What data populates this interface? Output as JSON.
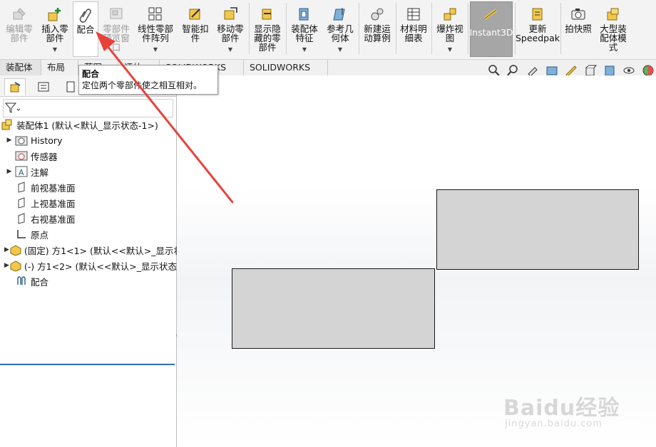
{
  "ribbon": {
    "buttons": [
      {
        "id": "edit-component",
        "label": "编辑零\n部件",
        "icon": "edit-component-icon",
        "disabled": true
      },
      {
        "id": "insert-component",
        "label": "插入零\n部件",
        "icon": "insert-component-icon"
      },
      {
        "id": "mate",
        "label": "配合",
        "icon": "paperclip-icon"
      },
      {
        "id": "component-preview",
        "label": "零部件\n预览窗\n口",
        "icon": "preview-window-icon",
        "disabled": true
      },
      {
        "id": "linear-pattern",
        "label": "线性零部\n件阵列",
        "icon": "linear-pattern-icon"
      },
      {
        "id": "smart-fasteners",
        "label": "智能扣\n件",
        "icon": "smart-fastener-icon"
      },
      {
        "id": "move-component",
        "label": "移动零\n部件",
        "icon": "move-component-icon"
      },
      {
        "id": "show-hidden",
        "label": "显示隐\n藏的零\n部件",
        "icon": "show-hidden-icon"
      },
      {
        "id": "assembly-features",
        "label": "装配体\n特征",
        "icon": "assembly-feature-icon"
      },
      {
        "id": "reference-geometry",
        "label": "参考几\n何体",
        "icon": "reference-geometry-icon"
      },
      {
        "id": "new-motion-study",
        "label": "新建运\n动算例",
        "icon": "motion-study-icon"
      },
      {
        "id": "bill-of-materials",
        "label": "材料明\n细表",
        "icon": "bom-icon"
      },
      {
        "id": "exploded-view",
        "label": "爆炸视\n图",
        "icon": "exploded-view-icon"
      },
      {
        "id": "instant3d",
        "label": "Instant3D",
        "icon": "instant3d-icon"
      },
      {
        "id": "update-speedpak",
        "label": "更新\nSpeedpak",
        "icon": "speedpak-icon"
      },
      {
        "id": "snapshot",
        "label": "拍快照",
        "icon": "camera-icon"
      },
      {
        "id": "large-assembly",
        "label": "大型装\n配体模\n式",
        "icon": "large-assembly-icon"
      }
    ]
  },
  "tabs": [
    "装配体",
    "布局",
    "草图",
    "评估",
    "SOLIDWORKS 插件",
    "SOLIDWORKS MBD"
  ],
  "tooltip": {
    "title": "配合",
    "description": "定位两个零部件使之相互相对。"
  },
  "tree": {
    "root": "装配体1  (默认<默认_显示状态-1>)",
    "items": [
      {
        "label": "History",
        "icon": "history-folder-icon",
        "expandable": true
      },
      {
        "label": "传感器",
        "icon": "sensor-icon",
        "expandable": false
      },
      {
        "label": "注解",
        "icon": "annotation-icon",
        "expandable": true
      },
      {
        "label": "前视基准面",
        "icon": "plane-icon",
        "expandable": false
      },
      {
        "label": "上视基准面",
        "icon": "plane-icon",
        "expandable": false
      },
      {
        "label": "右视基准面",
        "icon": "plane-icon",
        "expandable": false
      },
      {
        "label": "原点",
        "icon": "origin-icon",
        "expandable": false
      },
      {
        "label": "(固定) 方1<1> (默认<<默认>_显示状",
        "icon": "part-icon",
        "expandable": true
      },
      {
        "label": "(-) 方1<2> (默认<<默认>_显示状态",
        "icon": "part-icon",
        "expandable": true
      },
      {
        "label": "配合",
        "icon": "mates-icon",
        "expandable": false
      }
    ]
  },
  "watermark": {
    "brand": "Baidu经验",
    "url": "jingyan.baidu.com"
  },
  "colors": {
    "accent": "#2f6bb0",
    "arrow": "#e8413a",
    "block_fill": "#d4d4d4",
    "instant3d_active": "#a6a6a6"
  }
}
